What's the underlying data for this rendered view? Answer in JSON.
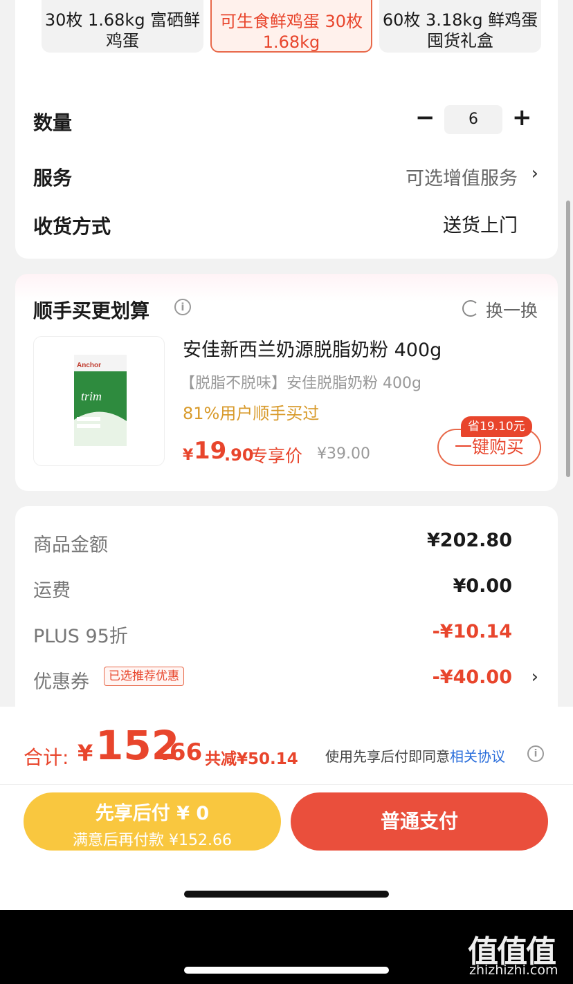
{
  "variants": [
    {
      "label_line1": "30枚 1.68kg 富硒鲜",
      "label_line2": "鸡蛋",
      "selected": false
    },
    {
      "label_line1": "可生食鲜鸡蛋 30枚",
      "label_line2": "1.68kg",
      "selected": true
    },
    {
      "label_line1": "60枚 3.18kg 鲜鸡蛋",
      "label_line2": "囤货礼盒",
      "selected": false
    }
  ],
  "quantity": {
    "label": "数量",
    "minus": "−",
    "value": "6",
    "plus": "+"
  },
  "service": {
    "label": "服务",
    "value": "可选增值服务",
    "chevron": "›"
  },
  "delivery": {
    "label": "收货方式",
    "value": "送货上门"
  },
  "recommend": {
    "title": "顺手买更划算",
    "info_icon": "i",
    "refresh_label": "换一换",
    "product": {
      "name": "安佳新西兰奶源脱脂奶粉 400g",
      "subtitle": "【脱脂不脱味】安佳脱脂奶粉 400g",
      "stat": "81%用户顺手买过",
      "price_yen": "¥",
      "price_int": "19",
      "price_dec": ".90",
      "price_tag": "专享价",
      "price_original": "¥39.00",
      "save_badge": "省19.10元",
      "buy_label": "一键购买",
      "image_brand": "Anchor",
      "image_name": "trim"
    }
  },
  "summary": {
    "goods": {
      "label": "商品金额",
      "value": "¥202.80"
    },
    "shipping": {
      "label": "运费",
      "value": "¥0.00"
    },
    "plus": {
      "label": "PLUS 95折",
      "value": "-¥10.14"
    },
    "coupon": {
      "label": "优惠券",
      "badge": "已选推荐优惠",
      "value": "-¥40.00",
      "chevron": "›"
    }
  },
  "bottom": {
    "total_label": "合计:",
    "total_yen": "¥",
    "total_int": "152",
    "total_dec": ".66",
    "total_saved": "共减¥50.14",
    "agree_text": "使用先享后付即同意",
    "agree_link": "相关协议",
    "agree_info": "i",
    "bnpl_main": "先享后付 ¥ 0",
    "bnpl_sub": "满意后再付款 ¥152.66",
    "pay_label": "普通支付"
  },
  "watermark": {
    "logo": "值值值",
    "url": "zhizhizhi.com"
  },
  "colors": {
    "accent": "#e8452c",
    "bnpl": "#f9c73f",
    "pay": "#ea4f3c",
    "link": "#2a6edb"
  }
}
